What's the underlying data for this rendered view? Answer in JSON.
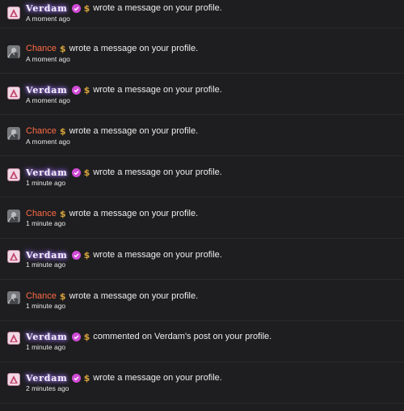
{
  "notifications": [
    {
      "user": "Verdam",
      "type": "verdam",
      "action": "wrote a message on your profile.",
      "time": "A moment ago"
    },
    {
      "user": "Chance",
      "type": "chance",
      "action": "wrote a message on your profile.",
      "time": "A moment ago"
    },
    {
      "user": "Verdam",
      "type": "verdam",
      "action": "wrote a message on your profile.",
      "time": "A moment ago"
    },
    {
      "user": "Chance",
      "type": "chance",
      "action": "wrote a message on your profile.",
      "time": "A moment ago"
    },
    {
      "user": "Verdam",
      "type": "verdam",
      "action": "wrote a message on your profile.",
      "time": "1 minute ago"
    },
    {
      "user": "Chance",
      "type": "chance",
      "action": "wrote a message on your profile.",
      "time": "1 minute ago"
    },
    {
      "user": "Verdam",
      "type": "verdam",
      "action": "wrote a message on your profile.",
      "time": "1 minute ago"
    },
    {
      "user": "Chance",
      "type": "chance",
      "action": "wrote a message on your profile.",
      "time": "1 minute ago"
    },
    {
      "user": "Verdam",
      "type": "verdam",
      "action": "commented on Verdam's post on your profile.",
      "time": "1 minute ago"
    },
    {
      "user": "Verdam",
      "type": "verdam",
      "action": "wrote a message on your profile.",
      "time": "2 minutes ago"
    }
  ],
  "icons": {
    "verified": "check-badge-icon",
    "currency": "dollar-coin-icon",
    "currency_glyph": "$"
  },
  "colors": {
    "background": "#1e1e20",
    "verdam_glow": "#b48cff",
    "chance_name": "#ff6a45",
    "badge": "#d04bd6",
    "coin": "#d6a33a"
  }
}
